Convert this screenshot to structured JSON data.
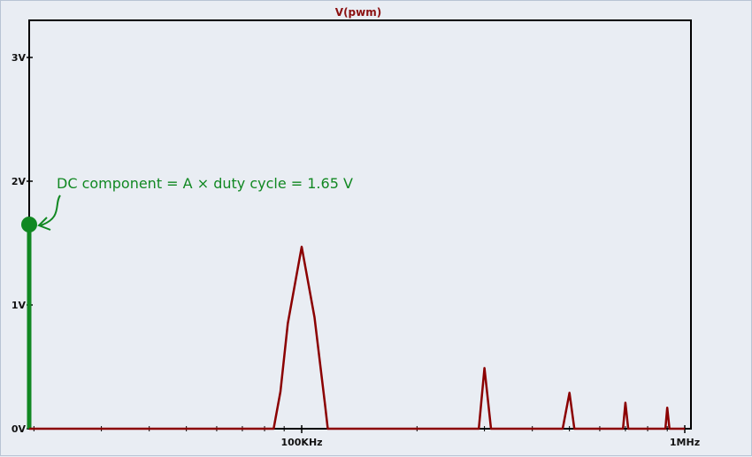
{
  "chart_data": {
    "type": "line",
    "title": "V(pwm)",
    "x_scale": "log",
    "x_range_hz": [
      10000,
      1000000
    ],
    "ylim": [
      0,
      3.3
    ],
    "y_ticks": [
      {
        "value": 0,
        "label": "0V"
      },
      {
        "value": 1,
        "label": "1V"
      },
      {
        "value": 2,
        "label": "2V"
      },
      {
        "value": 3,
        "label": "3V"
      }
    ],
    "x_tick_labels": [
      {
        "value": 100000,
        "label": "100KHz"
      },
      {
        "value": 1000000,
        "label": "1MHz"
      }
    ],
    "series": [
      {
        "color": "#8b0000",
        "points": [
          [
            10000,
            0
          ],
          [
            84500,
            0
          ],
          [
            88000,
            0.3
          ],
          [
            92000,
            0.85
          ],
          [
            100000,
            1.47
          ],
          [
            108000,
            0.9
          ],
          [
            115000,
            0.2
          ],
          [
            117000,
            0
          ],
          [
            200000,
            0
          ],
          [
            290000,
            0
          ],
          [
            300000,
            0.49
          ],
          [
            312000,
            0
          ],
          [
            480000,
            0
          ],
          [
            500000,
            0.29
          ],
          [
            515000,
            0
          ],
          [
            690000,
            0
          ],
          [
            700000,
            0.21
          ],
          [
            712000,
            0
          ],
          [
            890000,
            0
          ],
          [
            900000,
            0.17
          ],
          [
            912000,
            0
          ],
          [
            1000000,
            0
          ]
        ]
      }
    ],
    "dc_component": {
      "value": 1.65,
      "color": "#118822",
      "annotation": "DC component = A × duty cycle = 1.65 V"
    }
  }
}
